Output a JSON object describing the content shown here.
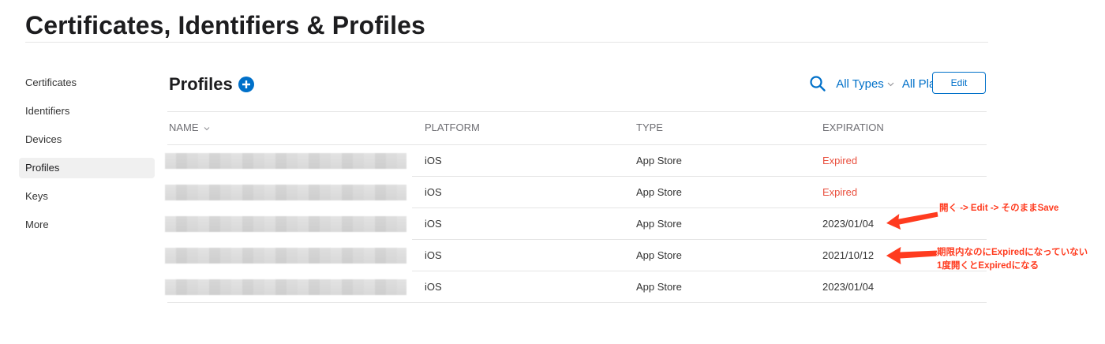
{
  "header": {
    "title": "Certificates, Identifiers & Profiles"
  },
  "sidebar": {
    "items": [
      {
        "label": "Certificates"
      },
      {
        "label": "Identifiers"
      },
      {
        "label": "Devices"
      },
      {
        "label": "Profiles",
        "active": true
      },
      {
        "label": "Keys"
      },
      {
        "label": "More"
      }
    ]
  },
  "main": {
    "section_title": "Profiles",
    "add_icon": "plus-circle-icon",
    "search_icon": "search-icon",
    "filters": {
      "types": "All Types",
      "platforms": "All Platforms"
    },
    "edit_label": "Edit"
  },
  "table": {
    "columns": {
      "name": "NAME",
      "platform": "PLATFORM",
      "type": "TYPE",
      "expiration": "EXPIRATION"
    },
    "rows": [
      {
        "name": "",
        "platform": "iOS",
        "type": "App Store",
        "expiration": "Expired",
        "status": "expired"
      },
      {
        "name": "",
        "platform": "iOS",
        "type": "App Store",
        "expiration": "Expired",
        "status": "expired"
      },
      {
        "name": "",
        "platform": "iOS",
        "type": "App Store",
        "expiration": "2023/01/04",
        "status": "active"
      },
      {
        "name": "",
        "platform": "iOS",
        "type": "App Store",
        "expiration": "2021/10/12",
        "status": "active"
      },
      {
        "name": "",
        "platform": "iOS",
        "type": "App Store",
        "expiration": "2023/01/04",
        "status": "active"
      }
    ]
  },
  "annotations": {
    "note1": "開く -> Edit -> そのままSave",
    "note2_line1": "期限内なのにExpiredになっていない",
    "note2_line2": "1度開くとExpiredになる"
  },
  "colors": {
    "accent": "#0070c9",
    "expired": "#e94e3c",
    "annotation": "#ff3b1f"
  }
}
